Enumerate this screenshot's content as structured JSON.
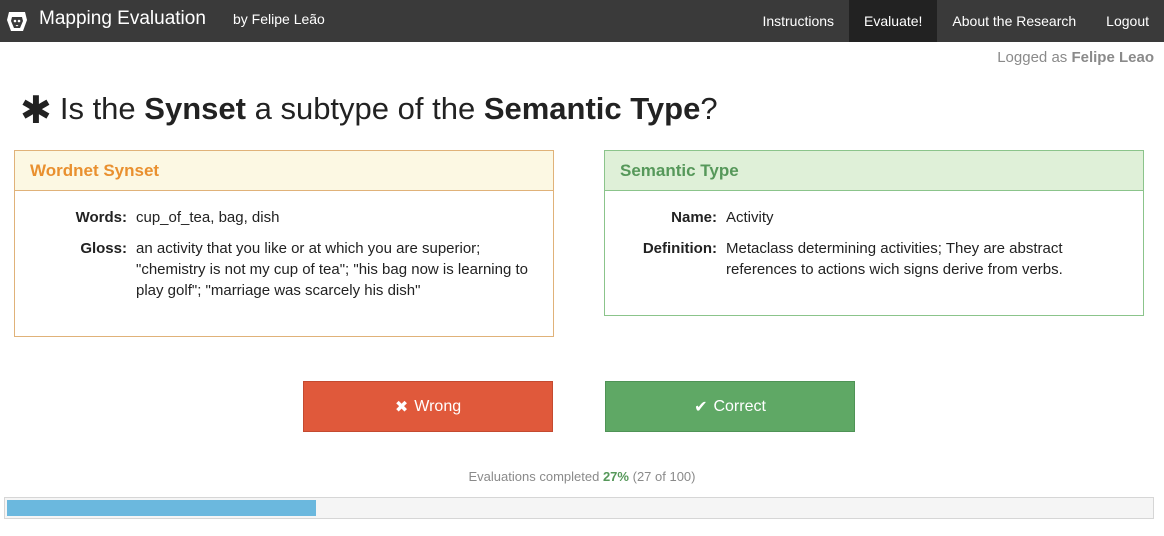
{
  "navbar": {
    "title": "Mapping Evaluation",
    "author": "by Felipe Leão",
    "items": [
      {
        "label": "Instructions",
        "active": false
      },
      {
        "label": "Evaluate!",
        "active": true
      },
      {
        "label": "About the Research",
        "active": false
      },
      {
        "label": "Logout",
        "active": false
      }
    ],
    "brand_icon": "lion-head-icon"
  },
  "user": {
    "prefix": "Logged as",
    "name": "Felipe Leao"
  },
  "question": {
    "icon": "asterisk-icon",
    "part1": "Is the",
    "term1": "Synset",
    "part2": "a subtype of the",
    "term2": "Semantic Type",
    "part3": "?"
  },
  "synset_panel": {
    "heading": "Wordnet Synset",
    "words_label": "Words:",
    "words": "cup_of_tea, bag, dish",
    "gloss_label": "Gloss:",
    "gloss": "an activity that you like or at which you are superior; \"chemistry is not my cup of tea\"; \"his bag now is learning to play golf\"; \"marriage was scarcely his dish\""
  },
  "semantic_panel": {
    "heading": "Semantic Type",
    "name_label": "Name:",
    "name": "Activity",
    "definition_label": "Definition:",
    "definition": "Metaclass determining activities; They are abstract references to actions wich signs derive from verbs."
  },
  "actions": {
    "wrong_label": "Wrong",
    "wrong_icon": "x-icon",
    "correct_label": "Correct",
    "correct_icon": "check-icon"
  },
  "progress": {
    "prefix": "Evaluations completed",
    "percent_label": "27%",
    "count_label": "(27 of 100)",
    "fraction": 0.27
  },
  "colors": {
    "navbar_bg": "#3a3a3a",
    "synset_accent": "#e9902f",
    "semantic_accent": "#56985a",
    "wrong_bg": "#e0593b",
    "correct_bg": "#5fa865",
    "progress_fill": "#6bb8de"
  }
}
